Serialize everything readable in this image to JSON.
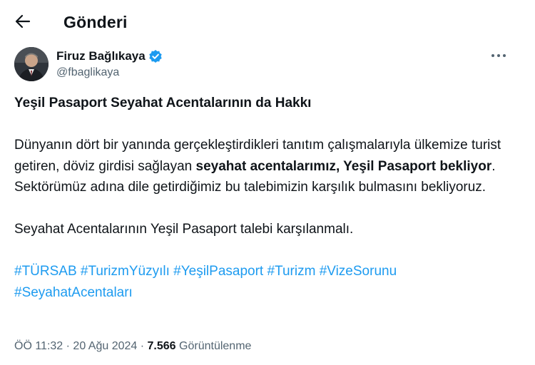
{
  "header": {
    "title": "Gönderi",
    "back_icon": "arrow-left-icon"
  },
  "author": {
    "name": "Firuz Bağlıkaya",
    "handle": "@fbaglikaya",
    "verified": true,
    "verified_color": "#1d9bf0"
  },
  "tweet": {
    "heading": "Yeşil Pasaport Seyahat Acentalarının da Hakkı",
    "p1_part1": "Dünyanın dört bir yanında gerçekleştirdikleri tanıtım çalışmalarıyla ülkemize turist getiren, döviz girdisi sağlayan ",
    "p1_bold": "seyahat acentalarımız, Yeşil Pasaport bekliyor",
    "p1_part2": ". Sektörümüz adına dile getirdiğimiz bu talebimizin karşılık bulmasını bekliyoruz.",
    "p2": "Seyahat Acentalarının Yeşil Pasaport talebi karşılanmalı.",
    "hashtags": [
      "#TÜRSAB",
      "#TurizmYüzyılı",
      "#YeşilPasaport",
      "#Turizm",
      "#VizeSorunu",
      "#SeyahatAcentaları"
    ],
    "link_color": "#1d9bf0"
  },
  "meta": {
    "time": "ÖÖ 11:32",
    "separator": "·",
    "date": "20 Ağu 2024",
    "views_count": "7.566",
    "views_label": "Görüntülenme"
  }
}
